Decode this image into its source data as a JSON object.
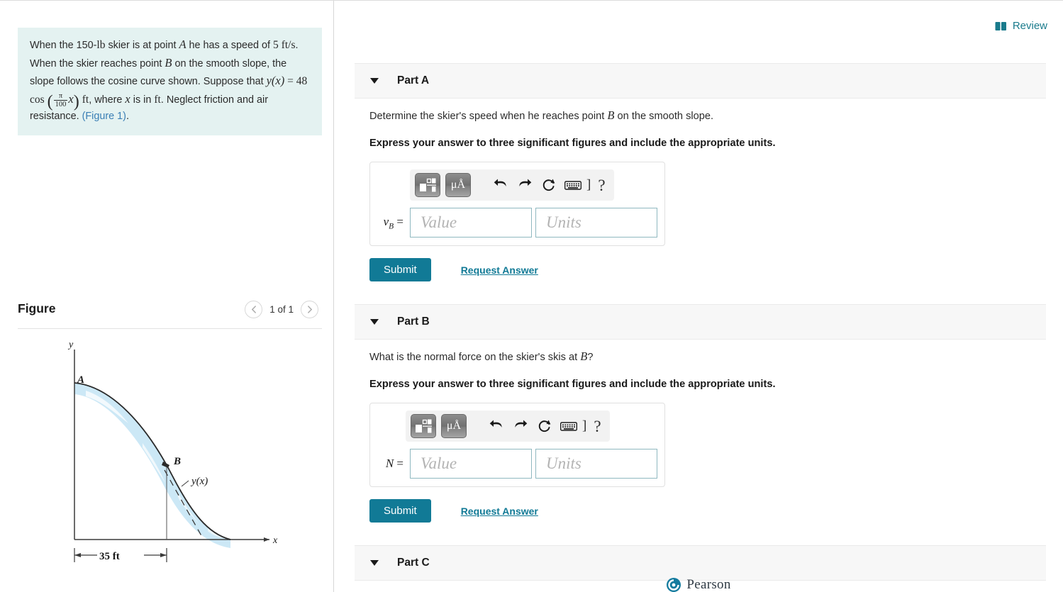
{
  "left": {
    "problem": {
      "line1_a": "When the 150-",
      "line1_lb": "lb",
      "line1_b": " skier is at point ",
      "line1_A": "A",
      "line1_c": " he has a speed of",
      "line2_num": "5",
      "line2_units": "ft/s",
      "line2_b": ". When the skier reaches point ",
      "line2_B": "B",
      "line2_c": " on the smooth",
      "line3": "slope, the slope follows the cosine curve shown.",
      "line4_a": "Suppose that ",
      "line4_y": "y",
      "line4_paren_x": "(x)",
      "line4_eq": " = 48 cos",
      "line4_pi": "π",
      "line4_100": "100",
      "line4_x": "x",
      "line4_ft": "ft",
      "line4_where": ", where ",
      "line4_x2": "x",
      "line4_is": " is",
      "line5_a": "in ",
      "line5_ft": "ft",
      "line5_b": ". Neglect friction and air resistance. ",
      "line5_link": "(Figure 1)",
      "line5_c": "."
    },
    "figure": {
      "title": "Figure",
      "pager_label": "1 of 1",
      "prev_icon": "chevron-left-icon",
      "next_icon": "chevron-right-icon",
      "labels": {
        "y_axis": "y",
        "x_axis": "x",
        "point_a": "A",
        "point_b": "B",
        "curve": "y(x)",
        "dimension": "35 ft"
      }
    }
  },
  "right": {
    "review": {
      "label": "Review",
      "icon": "book-icon",
      "color": "#1a7b8c"
    },
    "parts": [
      {
        "header": "Part A",
        "question": "Determine the skier's speed when he reaches point B on the smooth slope.",
        "question_pre": "Determine the skier's speed when he reaches point ",
        "question_var": "B",
        "question_post": " on the smooth slope.",
        "instruction": "Express your answer to three significant figures and include the appropriate units.",
        "variable": "v",
        "variable_sub": "B",
        "equals": " =",
        "value_placeholder": "Value",
        "units_placeholder": "Units",
        "submit_label": "Submit",
        "request_label": "Request Answer"
      },
      {
        "header": "Part B",
        "question_pre": "What is the normal force on the skier's skis at ",
        "question_var": "B",
        "question_post": "?",
        "instruction": "Express your answer to three significant figures and include the appropriate units.",
        "variable": "N",
        "variable_sub": "",
        "equals": " =",
        "value_placeholder": "Value",
        "units_placeholder": "Units",
        "submit_label": "Submit",
        "request_label": "Request Answer"
      },
      {
        "header": "Part C"
      }
    ],
    "toolbar": {
      "template_icon": "math-template-icon",
      "units_icon": "micro-angstrom-icon",
      "units_label": "μÅ",
      "undo_icon": "undo-icon",
      "redo_icon": "redo-icon",
      "reset_icon": "reset-icon",
      "keyboard_icon": "keyboard-icon",
      "bracket": "]",
      "help_label": "?"
    },
    "footer": {
      "brand": "Pearson",
      "logo_icon": "pearson-logo-icon",
      "color": "#147b9e"
    }
  },
  "colors": {
    "accent_teal": "#117a96",
    "problem_bg": "#e4f2f1",
    "part_header_bg": "#f7f7f7",
    "link_blue": "#3a7fb5",
    "snow_blue": "#cbe7f5"
  }
}
